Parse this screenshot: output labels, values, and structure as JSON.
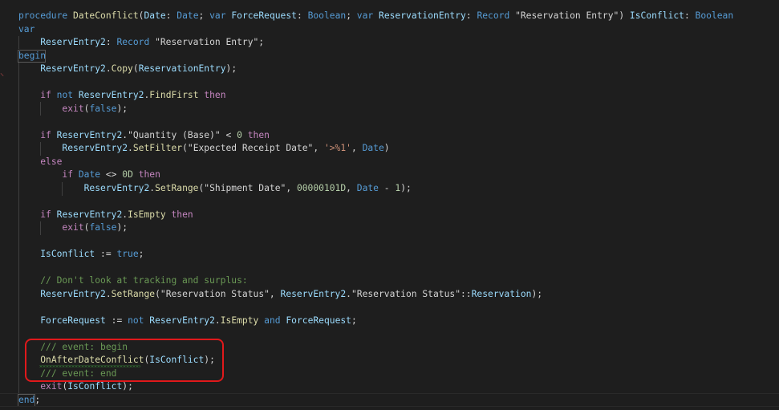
{
  "editor": {
    "lines": [
      [
        [
          "kw",
          "procedure"
        ],
        [
          "txt",
          " "
        ],
        [
          "fn",
          "DateConflict"
        ],
        [
          "op",
          "("
        ],
        [
          "var",
          "Date"
        ],
        [
          "op",
          ": "
        ],
        [
          "kw",
          "Date"
        ],
        [
          "op",
          "; "
        ],
        [
          "kw",
          "var"
        ],
        [
          "txt",
          " "
        ],
        [
          "var",
          "ForceRequest"
        ],
        [
          "op",
          ": "
        ],
        [
          "kw",
          "Boolean"
        ],
        [
          "op",
          "; "
        ],
        [
          "kw",
          "var"
        ],
        [
          "txt",
          " "
        ],
        [
          "var",
          "ReservationEntry"
        ],
        [
          "op",
          ": "
        ],
        [
          "kw",
          "Record"
        ],
        [
          "txt",
          " "
        ],
        [
          "txt",
          "\"Reservation Entry\""
        ],
        [
          "op",
          ") "
        ],
        [
          "var",
          "IsConflict"
        ],
        [
          "op",
          ": "
        ],
        [
          "kw",
          "Boolean"
        ]
      ],
      [
        [
          "kw",
          "var"
        ]
      ],
      [
        [
          "txt",
          "    "
        ],
        [
          "var",
          "ReservEntry2"
        ],
        [
          "op",
          ": "
        ],
        [
          "kw",
          "Record"
        ],
        [
          "txt",
          " \"Reservation Entry\";"
        ]
      ],
      [
        [
          "kw",
          "begin"
        ]
      ],
      [
        [
          "txt",
          "    "
        ],
        [
          "var",
          "ReservEntry2"
        ],
        [
          "op",
          "."
        ],
        [
          "fn",
          "Copy"
        ],
        [
          "op",
          "("
        ],
        [
          "var",
          "ReservationEntry"
        ],
        [
          "op",
          ");"
        ]
      ],
      [],
      [
        [
          "txt",
          "    "
        ],
        [
          "ctl",
          "if"
        ],
        [
          "txt",
          " "
        ],
        [
          "kw",
          "not"
        ],
        [
          "txt",
          " "
        ],
        [
          "var",
          "ReservEntry2"
        ],
        [
          "op",
          "."
        ],
        [
          "fn",
          "FindFirst"
        ],
        [
          "txt",
          " "
        ],
        [
          "ctl",
          "then"
        ]
      ],
      [
        [
          "txt",
          "        "
        ],
        [
          "ctl",
          "exit"
        ],
        [
          "op",
          "("
        ],
        [
          "kw",
          "false"
        ],
        [
          "op",
          ");"
        ]
      ],
      [],
      [
        [
          "txt",
          "    "
        ],
        [
          "ctl",
          "if"
        ],
        [
          "txt",
          " "
        ],
        [
          "var",
          "ReservEntry2"
        ],
        [
          "op",
          "."
        ],
        [
          "txt",
          "\"Quantity (Base)\""
        ],
        [
          "op",
          " < "
        ],
        [
          "num",
          "0"
        ],
        [
          "txt",
          " "
        ],
        [
          "ctl",
          "then"
        ]
      ],
      [
        [
          "txt",
          "        "
        ],
        [
          "var",
          "ReservEntry2"
        ],
        [
          "op",
          "."
        ],
        [
          "fn",
          "SetFilter"
        ],
        [
          "op",
          "("
        ],
        [
          "txt",
          "\"Expected Receipt Date\""
        ],
        [
          "op",
          ", "
        ],
        [
          "str",
          "'>%1'"
        ],
        [
          "op",
          ", "
        ],
        [
          "kw",
          "Date"
        ],
        [
          "op",
          ")"
        ]
      ],
      [
        [
          "txt",
          "    "
        ],
        [
          "ctl",
          "else"
        ]
      ],
      [
        [
          "txt",
          "        "
        ],
        [
          "ctl",
          "if"
        ],
        [
          "txt",
          " "
        ],
        [
          "kw",
          "Date"
        ],
        [
          "op",
          " <> "
        ],
        [
          "num",
          "0D"
        ],
        [
          "txt",
          " "
        ],
        [
          "ctl",
          "then"
        ]
      ],
      [
        [
          "txt",
          "            "
        ],
        [
          "var",
          "ReservEntry2"
        ],
        [
          "op",
          "."
        ],
        [
          "fn",
          "SetRange"
        ],
        [
          "op",
          "("
        ],
        [
          "txt",
          "\"Shipment Date\""
        ],
        [
          "op",
          ", "
        ],
        [
          "num",
          "00000101D"
        ],
        [
          "op",
          ", "
        ],
        [
          "kw",
          "Date"
        ],
        [
          "op",
          " - "
        ],
        [
          "num",
          "1"
        ],
        [
          "op",
          ");"
        ]
      ],
      [],
      [
        [
          "txt",
          "    "
        ],
        [
          "ctl",
          "if"
        ],
        [
          "txt",
          " "
        ],
        [
          "var",
          "ReservEntry2"
        ],
        [
          "op",
          "."
        ],
        [
          "fn",
          "IsEmpty"
        ],
        [
          "txt",
          " "
        ],
        [
          "ctl",
          "then"
        ]
      ],
      [
        [
          "txt",
          "        "
        ],
        [
          "ctl",
          "exit"
        ],
        [
          "op",
          "("
        ],
        [
          "kw",
          "false"
        ],
        [
          "op",
          ");"
        ]
      ],
      [],
      [
        [
          "txt",
          "    "
        ],
        [
          "var",
          "IsConflict"
        ],
        [
          "op",
          " := "
        ],
        [
          "kw",
          "true"
        ],
        [
          "op",
          ";"
        ]
      ],
      [],
      [
        [
          "txt",
          "    "
        ],
        [
          "cm",
          "// Don't look at tracking and surplus:"
        ]
      ],
      [
        [
          "txt",
          "    "
        ],
        [
          "var",
          "ReservEntry2"
        ],
        [
          "op",
          "."
        ],
        [
          "fn",
          "SetRange"
        ],
        [
          "op",
          "("
        ],
        [
          "txt",
          "\"Reservation Status\""
        ],
        [
          "op",
          ", "
        ],
        [
          "var",
          "ReservEntry2"
        ],
        [
          "op",
          "."
        ],
        [
          "txt",
          "\"Reservation Status\""
        ],
        [
          "op",
          "::"
        ],
        [
          "var",
          "Reservation"
        ],
        [
          "op",
          ");"
        ]
      ],
      [],
      [
        [
          "txt",
          "    "
        ],
        [
          "var",
          "ForceRequest"
        ],
        [
          "op",
          " := "
        ],
        [
          "kw",
          "not"
        ],
        [
          "txt",
          " "
        ],
        [
          "var",
          "ReservEntry2"
        ],
        [
          "op",
          "."
        ],
        [
          "fn",
          "IsEmpty"
        ],
        [
          "txt",
          " "
        ],
        [
          "kw",
          "and"
        ],
        [
          "txt",
          " "
        ],
        [
          "var",
          "ForceRequest"
        ],
        [
          "op",
          ";"
        ]
      ],
      [],
      [
        [
          "txt",
          "    "
        ],
        [
          "cm",
          "/// event: begin"
        ]
      ],
      [
        [
          "txt",
          "    "
        ],
        [
          "fn",
          "OnAfterDateConflict"
        ],
        [
          "op",
          "("
        ],
        [
          "var",
          "IsConflict"
        ],
        [
          "op",
          ");"
        ]
      ],
      [
        [
          "txt",
          "    "
        ],
        [
          "cm",
          "/// event: end"
        ]
      ],
      [
        [
          "txt",
          "    "
        ],
        [
          "ctl",
          "exit"
        ],
        [
          "op",
          "("
        ],
        [
          "var",
          "IsConflict"
        ],
        [
          "op",
          ");"
        ]
      ],
      [
        [
          "kw",
          "end"
        ],
        [
          "op",
          ";"
        ]
      ]
    ]
  }
}
